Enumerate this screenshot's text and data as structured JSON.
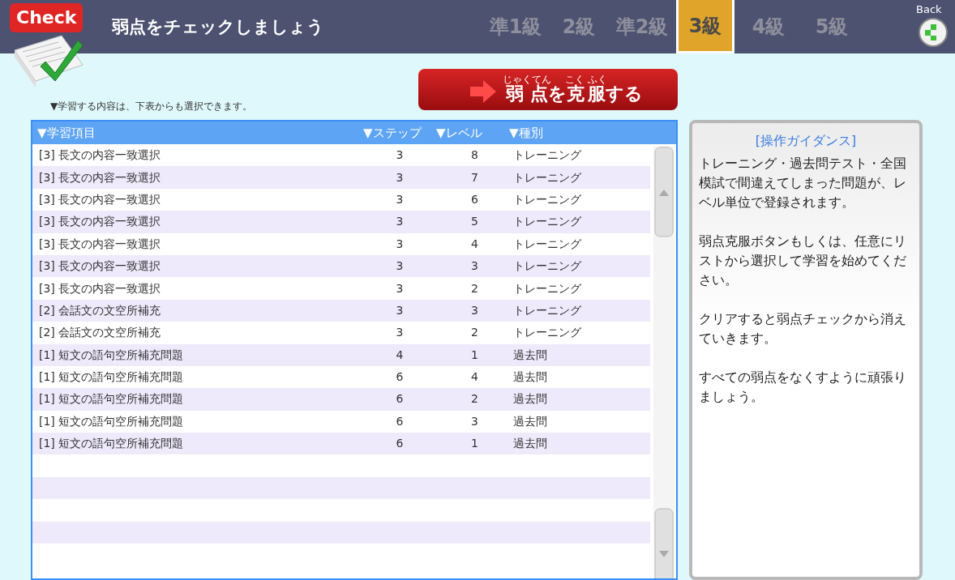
{
  "header": {
    "logo": "Check",
    "title": "弱点をチェックしましょう"
  },
  "grades": [
    {
      "label": "準1級",
      "selected": false
    },
    {
      "label": "2級",
      "selected": false
    },
    {
      "label": "準2級",
      "selected": false
    },
    {
      "label": "3級",
      "selected": true
    },
    {
      "label": "4級",
      "selected": false
    },
    {
      "label": "5級",
      "selected": false
    }
  ],
  "back": {
    "label": "Back"
  },
  "hint": "▼学習する内容は、下表からも選択できます。",
  "overcome_button": [
    {
      "text": "弱点",
      "ruby": "じゃくてん"
    },
    {
      "text": "を"
    },
    {
      "text": "克服",
      "ruby": "こく ふく"
    },
    {
      "text": "する"
    }
  ],
  "table": {
    "columns": [
      "▼学習項目",
      "▼ステップ",
      "▼レベル",
      "▼種別"
    ],
    "rows": [
      [
        "[3] 長文の内容一致選択",
        "3",
        "8",
        "トレーニング"
      ],
      [
        "[3] 長文の内容一致選択",
        "3",
        "7",
        "トレーニング"
      ],
      [
        "[3] 長文の内容一致選択",
        "3",
        "6",
        "トレーニング"
      ],
      [
        "[3] 長文の内容一致選択",
        "3",
        "5",
        "トレーニング"
      ],
      [
        "[3] 長文の内容一致選択",
        "3",
        "4",
        "トレーニング"
      ],
      [
        "[3] 長文の内容一致選択",
        "3",
        "3",
        "トレーニング"
      ],
      [
        "[3] 長文の内容一致選択",
        "3",
        "2",
        "トレーニング"
      ],
      [
        "[2] 会話文の文空所補充",
        "3",
        "3",
        "トレーニング"
      ],
      [
        "[2] 会話文の文空所補充",
        "3",
        "2",
        "トレーニング"
      ],
      [
        "[1] 短文の語句空所補充問題",
        "4",
        "1",
        "過去問"
      ],
      [
        "[1] 短文の語句空所補充問題",
        "6",
        "4",
        "過去問"
      ],
      [
        "[1] 短文の語句空所補充問題",
        "6",
        "2",
        "過去問"
      ],
      [
        "[1] 短文の語句空所補充問題",
        "6",
        "3",
        "過去問"
      ],
      [
        "[1] 短文の語句空所補充問題",
        "6",
        "1",
        "過去問"
      ]
    ]
  },
  "guidance": {
    "title": "[操作ガイダンス]",
    "paragraphs": [
      "トレーニング・過去問テスト・全国模試で間違えてしまった問題が、レベル単位で登録されます。",
      "弱点克服ボタンもしくは、任意にリストから選択して学習を始めてください。",
      "クリアすると弱点チェックから消えていきます。",
      "すべての弱点をなくすように頑張りましょう。"
    ]
  }
}
